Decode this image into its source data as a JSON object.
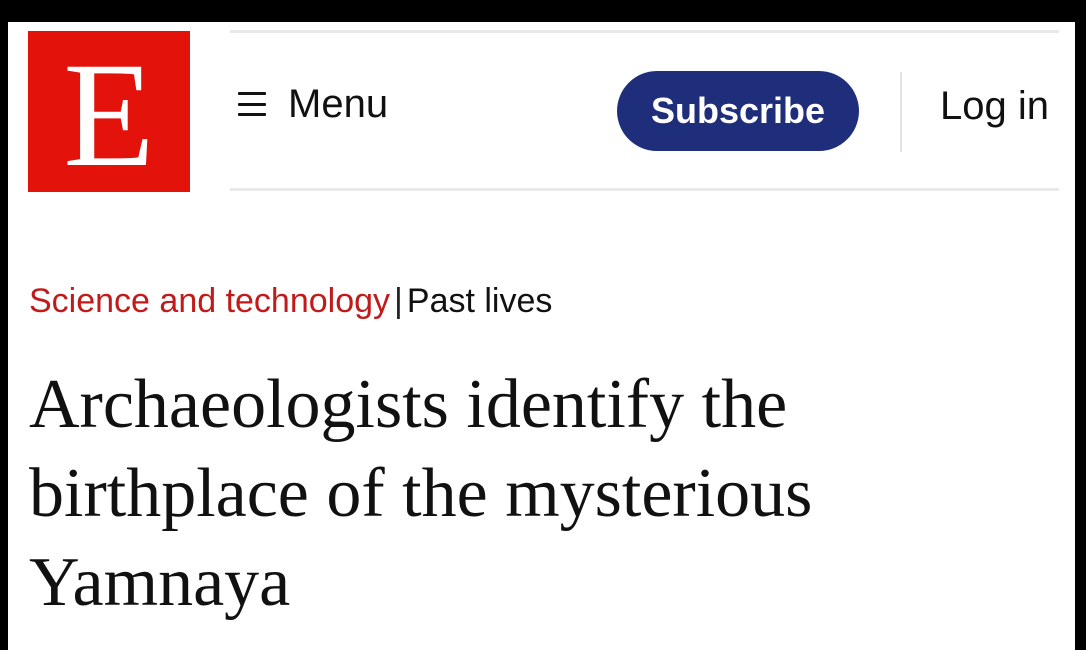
{
  "header": {
    "logo_letter": "E",
    "menu_label": "Menu",
    "subscribe_label": "Subscribe",
    "login_label": "Log in"
  },
  "article": {
    "section": "Science and technology",
    "separator": "|",
    "topic": "Past lives",
    "headline_lines": [
      "Archaeologists identify the",
      "birthplace of the mysterious",
      "Yamnaya"
    ]
  },
  "icons": {
    "menu": "hamburger-icon"
  },
  "colors": {
    "logo_red": "#e3120b",
    "subscribe_blue": "#1f2e7a",
    "section_red": "#c11a1a",
    "text": "#111111"
  }
}
